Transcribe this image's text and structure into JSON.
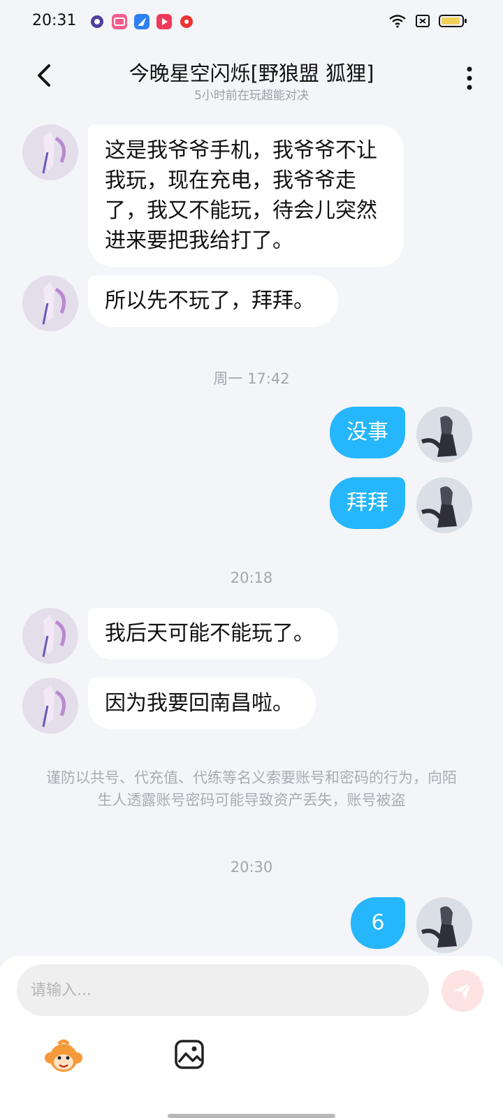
{
  "status_bar": {
    "time": "20:31",
    "app_icons": [
      "telescope-icon",
      "bilibili-icon",
      "feather-icon",
      "video-play-icon",
      "music-icon"
    ],
    "battery_color": "#f1d15a"
  },
  "header": {
    "title": "今晚星空闪烁[野狼盟  狐狸]",
    "subtitle": "5小时前在玩超能对决"
  },
  "messages": [
    {
      "from": "them",
      "text": "这是我爷爷手机，我爷爷不让我玩，现在充电，我爷爷走了，我又不能玩，待会儿突然进来要把我给打了。"
    },
    {
      "from": "them",
      "text": "所以先不玩了，拜拜。"
    },
    {
      "type": "time",
      "text": "周一 17:42"
    },
    {
      "from": "me",
      "text": "没事"
    },
    {
      "from": "me",
      "text": "拜拜"
    },
    {
      "type": "time",
      "text": "20:18"
    },
    {
      "from": "them",
      "text": "我后天可能不能玩了。"
    },
    {
      "from": "them",
      "text": "因为我要回南昌啦。"
    },
    {
      "type": "notice",
      "text": "谨防以共号、代充值、代练等名义索要账号和密码的行为，向陌生人透露账号密码可能导致资产丢失，账号被盗"
    },
    {
      "type": "time",
      "text": "20:30"
    },
    {
      "from": "me",
      "text": "6"
    }
  ],
  "composer": {
    "placeholder": "请输入...",
    "send_color": "#fde3e2"
  },
  "colors": {
    "my_bubble": "#25b6fb",
    "their_bubble": "#ffffff",
    "background": "#f3f5f8"
  }
}
